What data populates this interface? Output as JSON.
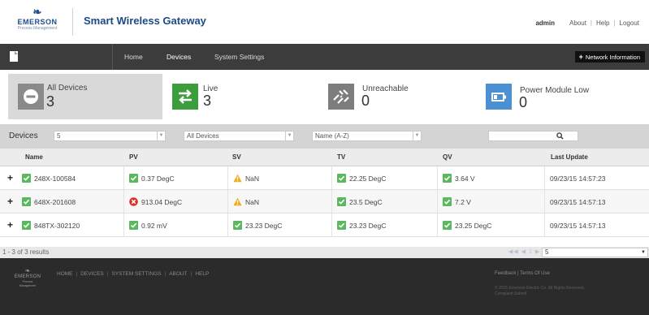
{
  "header": {
    "logo": {
      "name": "EMERSON",
      "sub": "Process Management"
    },
    "title": "Smart Wireless Gateway",
    "user": "admin",
    "links": [
      "About",
      "Help",
      "Logout"
    ]
  },
  "nav": {
    "tabs": [
      "Home",
      "Devices",
      "System Settings"
    ],
    "active_tab": "Devices",
    "network_button": "Network Information"
  },
  "stats": [
    {
      "label": "All Devices",
      "count": "3",
      "color": "#8a8a8a",
      "icon": "minus-circle-icon",
      "active": true
    },
    {
      "label": "Live",
      "count": "3",
      "color": "#3c9d3c",
      "icon": "arrows-exchange-icon"
    },
    {
      "label": "Unreachable",
      "count": "0",
      "color": "#7d7d7d",
      "icon": "broken-link-icon"
    },
    {
      "label": "Power Module Low",
      "count": "0",
      "color": "#4a90d2",
      "icon": "battery-low-icon"
    }
  ],
  "filters": {
    "title": "Devices",
    "page_size": "5",
    "device_filter": "All Devices",
    "sort": "Name (A-Z)",
    "search_placeholder": ""
  },
  "table": {
    "columns": [
      "Name",
      "PV",
      "SV",
      "TV",
      "QV",
      "Last Update"
    ],
    "rows": [
      {
        "name": "248X-100584",
        "name_status": "ok",
        "pv": "0.37 DegC",
        "pv_status": "ok",
        "sv": "NaN",
        "sv_status": "warning",
        "tv": "22.25 DegC",
        "tv_status": "ok",
        "qv": "3.64 V",
        "qv_status": "ok",
        "last_update": "09/23/15 14:57:23"
      },
      {
        "name": "648X-201608",
        "name_status": "ok",
        "pv": "913.04 DegC",
        "pv_status": "error",
        "sv": "NaN",
        "sv_status": "warning",
        "tv": "23.5 DegC",
        "tv_status": "ok",
        "qv": "7.2 V",
        "qv_status": "ok",
        "last_update": "09/23/15 14:57:13"
      },
      {
        "name": "848TX-302120",
        "name_status": "ok",
        "pv": "0.92 mV",
        "pv_status": "ok",
        "sv": "23.23 DegC",
        "sv_status": "ok",
        "tv": "23.23 DegC",
        "tv_status": "ok",
        "qv": "23.25 DegC",
        "qv_status": "ok",
        "last_update": "09/23/15 14:57:13"
      }
    ]
  },
  "pager": {
    "results": "1 - 3 of 3 results",
    "page_size": "5"
  },
  "footer": {
    "nav": [
      "HOME",
      "DEVICES",
      "SYSTEM SETTINGS",
      "ABOUT",
      "HELP"
    ],
    "links": "Feedback | Terms Of Use",
    "copyright": "© 2015 Emerson Electric Co. All Rights Reserved.",
    "copyright2": "Complaint Submit"
  },
  "colors": {
    "ok": "#5cb85c",
    "warning": "#f0ad1e",
    "error": "#d9302a",
    "nav_bg": "#3c3c3c",
    "brand": "#1c4a86"
  }
}
